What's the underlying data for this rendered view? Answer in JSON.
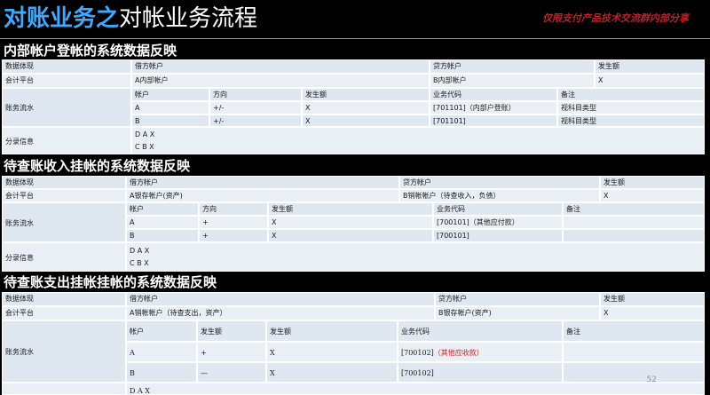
{
  "header": {
    "title_highlight": "对账业务之",
    "title_rest": "对帐业务流程",
    "watermark": "仅限支付产品技术交流群内部分享",
    "accent_color": "#3fa9ff",
    "watermark_color": "#c0202a"
  },
  "section1": {
    "heading": "内部帐户登帐的系统数据反映",
    "row_labels": [
      "数据体现",
      "会计平台",
      "账务流水",
      "分录信息"
    ],
    "top_headers": [
      "借方帐户",
      "贷方帐户",
      "发生额"
    ],
    "platform": [
      "A内部帐户",
      "B内部帐户",
      "X"
    ],
    "flow_headers": [
      "帐户",
      "方向",
      "发生额",
      "业务代码",
      "备注"
    ],
    "flow_rows": [
      [
        "A",
        "+/-",
        "X",
        "[701101]（内部户登账）",
        "视科目类型"
      ],
      [
        "B",
        "+/-",
        "X",
        "[701101]",
        "视科目类型"
      ]
    ],
    "entries": [
      "D A X",
      "C B X"
    ]
  },
  "section2": {
    "heading": "待查账收入挂帐的系统数据反映",
    "row_labels": [
      "数据体现",
      "会计平台",
      "账务流水",
      "分录信息"
    ],
    "top_headers": [
      "借方帐户",
      "贷方帐户",
      "发生额"
    ],
    "platform": [
      "A银存帐户(资产)",
      "B销帐帐户（待查收入，负债）",
      "X"
    ],
    "flow_headers": [
      "帐户",
      "方向",
      "发生额",
      "业务代码",
      "备注"
    ],
    "flow_rows": [
      [
        "A",
        "+",
        "X",
        "[700101]（其他应付款）",
        ""
      ],
      [
        "B",
        "+",
        "X",
        "[700101]",
        ""
      ]
    ],
    "entries": [
      "D A X",
      "C B X"
    ]
  },
  "section3": {
    "heading": "待查账支出挂帐挂帐的系统数据反映",
    "row_labels": [
      "数据体现",
      "会计平台",
      "账务流水"
    ],
    "top_headers": [
      "借方帐户",
      "贷方帐户",
      "发生额"
    ],
    "platform": [
      "A销帐帐户（待查支出，资产）",
      "B银存帐户(资产)",
      "X"
    ],
    "flow_headers": [
      "帐户",
      "发生额",
      "发生额",
      "业务代码",
      "备注"
    ],
    "flow_rows": [
      [
        "A",
        "+",
        "X",
        "[700102]",
        "（其他应收款）"
      ],
      [
        "B",
        "—",
        "X",
        "[700102]",
        ""
      ]
    ],
    "entries": [
      "D A X"
    ]
  },
  "page_number": "52"
}
